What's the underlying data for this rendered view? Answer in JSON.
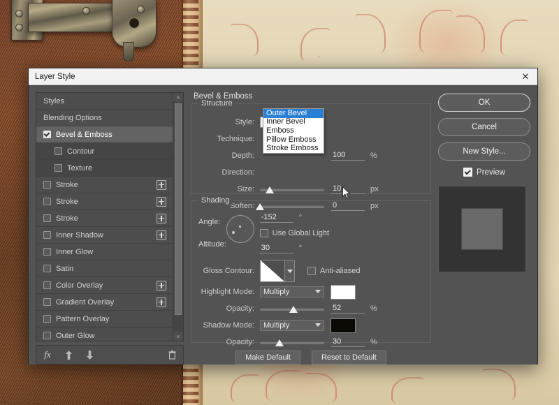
{
  "window": {
    "title": "Layer Style",
    "close_icon": "close-icon",
    "close_label": "✕"
  },
  "styles_panel": {
    "items": [
      {
        "label": "Styles",
        "checkbox": "none",
        "plus": false,
        "selected": false,
        "indent": 0
      },
      {
        "label": "Blending Options",
        "checkbox": "none",
        "plus": false,
        "selected": false,
        "indent": 0
      },
      {
        "label": "Bevel & Emboss",
        "checkbox": "checked",
        "plus": false,
        "selected": true,
        "indent": 0
      },
      {
        "label": "Contour",
        "checkbox": "unchecked",
        "plus": false,
        "selected": false,
        "indent": 1
      },
      {
        "label": "Texture",
        "checkbox": "unchecked",
        "plus": false,
        "selected": false,
        "indent": 1
      },
      {
        "label": "Stroke",
        "checkbox": "unchecked",
        "plus": true,
        "selected": false,
        "indent": 0
      },
      {
        "label": "Stroke",
        "checkbox": "unchecked",
        "plus": true,
        "selected": false,
        "indent": 0
      },
      {
        "label": "Stroke",
        "checkbox": "unchecked",
        "plus": true,
        "selected": false,
        "indent": 0
      },
      {
        "label": "Inner Shadow",
        "checkbox": "unchecked",
        "plus": true,
        "selected": false,
        "indent": 0
      },
      {
        "label": "Inner Glow",
        "checkbox": "unchecked",
        "plus": false,
        "selected": false,
        "indent": 0
      },
      {
        "label": "Satin",
        "checkbox": "unchecked",
        "plus": false,
        "selected": false,
        "indent": 0
      },
      {
        "label": "Color Overlay",
        "checkbox": "unchecked",
        "plus": true,
        "selected": false,
        "indent": 0
      },
      {
        "label": "Gradient Overlay",
        "checkbox": "unchecked",
        "plus": true,
        "selected": false,
        "indent": 0
      },
      {
        "label": "Pattern Overlay",
        "checkbox": "unchecked",
        "plus": false,
        "selected": false,
        "indent": 0
      },
      {
        "label": "Outer Glow",
        "checkbox": "unchecked",
        "plus": false,
        "selected": false,
        "indent": 0
      }
    ],
    "scroll_up_glyph": "∧",
    "scroll_down_glyph": "∨",
    "toolbar": {
      "fx_label": "fx",
      "move_up_glyph": "⬆",
      "move_down_glyph": "⬇",
      "delete_glyph": "🗑"
    }
  },
  "options": {
    "section_title": "Bevel & Emboss",
    "structure": {
      "legend": "Structure",
      "style_label": "Style:",
      "style_value": "Outer Bevel",
      "technique_label": "Technique:",
      "depth_label": "Depth:",
      "depth_value": "100",
      "depth_unit": "%",
      "direction_label": "Direction:",
      "size_label": "Size:",
      "size_value": "10",
      "size_unit": "px",
      "size_percent": 15,
      "soften_label": "Soften:",
      "soften_value": "0",
      "soften_unit": "px",
      "soften_percent": 0
    },
    "shading": {
      "legend": "Shading",
      "angle_label": "Angle:",
      "angle_value": "-152",
      "angle_unit": "°",
      "use_global_light_label": "Use Global Light",
      "use_global_light_checked": false,
      "altitude_label": "Altitude:",
      "altitude_value": "30",
      "altitude_unit": "°",
      "gloss_contour_label": "Gloss Contour:",
      "anti_aliased_label": "Anti-aliased",
      "anti_aliased_checked": false,
      "highlight_mode_label": "Highlight Mode:",
      "highlight_mode_value": "Multiply",
      "highlight_color": "#ffffff",
      "highlight_opacity_label": "Opacity:",
      "highlight_opacity_value": "52",
      "highlight_opacity_unit": "%",
      "highlight_opacity_percent": 52,
      "shadow_mode_label": "Shadow Mode:",
      "shadow_mode_value": "Multiply",
      "shadow_color": "#0b0903",
      "shadow_opacity_label": "Opacity:",
      "shadow_opacity_value": "30",
      "shadow_opacity_unit": "%",
      "shadow_opacity_percent": 30
    },
    "make_default_label": "Make Default",
    "reset_to_default_label": "Reset to Default"
  },
  "dropdown": {
    "open": true,
    "options": [
      "Outer Bevel",
      "Inner Bevel",
      "Emboss",
      "Pillow Emboss",
      "Stroke Emboss"
    ],
    "selected_index": 0
  },
  "right": {
    "ok_label": "OK",
    "cancel_label": "Cancel",
    "new_style_label": "New Style...",
    "preview_label": "Preview",
    "preview_checked": true
  }
}
